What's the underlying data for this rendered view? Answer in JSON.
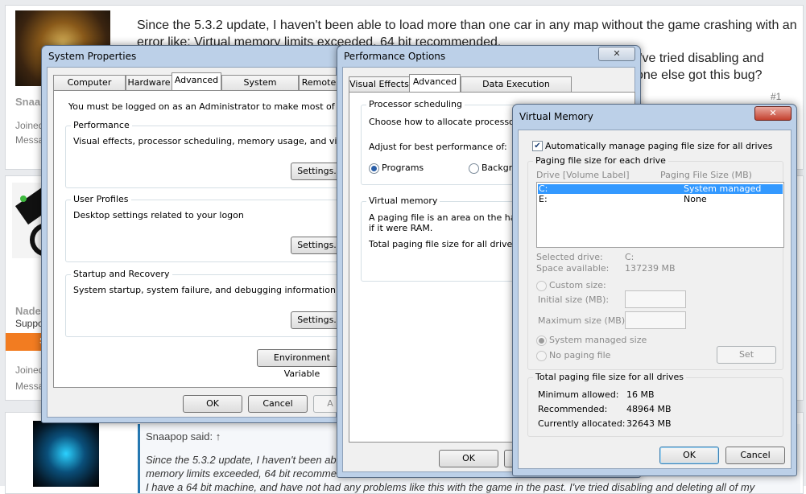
{
  "forum": {
    "post1": {
      "username": "Snaa",
      "joined_label": "Joined",
      "messages_label": "Messa",
      "line1": "Since the 5.3.2 update, I haven't been able to load more than one car in any map without the game crashing with an",
      "line2": "error like: Virtual memory limits exceeded, 64 bit recommended.",
      "line3_right": "I've tried disabling and",
      "line4_right": "one else got this bug?",
      "post_number": "#1"
    },
    "post2": {
      "username": "Nade",
      "role": "Suppo",
      "badge": "S",
      "joined_label": "Joined",
      "messages_label": "Messa"
    },
    "post3": {
      "quote_header": "Snaapop said: ↑",
      "quote_line1": "Since the 5.3.2 update, I haven't been able",
      "quote_line2": "memory limits exceeded, 64 bit recommen",
      "quote_line3": "I have a 64 bit machine, and have not had any problems like this with the game in the past. I've tried disabling and deleting all of my"
    }
  },
  "system_properties": {
    "title": "System Properties",
    "tabs": [
      "Computer Name",
      "Hardware",
      "Advanced",
      "System Protection",
      "Remote"
    ],
    "active_tab": "Advanced",
    "admin_note": "You must be logged on as an Administrator to make most of these chan",
    "performance": {
      "label": "Performance",
      "desc": "Visual effects, processor scheduling, memory usage, and virtual memo",
      "button": "Settings..."
    },
    "user_profiles": {
      "label": "User Profiles",
      "desc": "Desktop settings related to your logon",
      "button": "Settings..."
    },
    "startup": {
      "label": "Startup and Recovery",
      "desc": "System startup, system failure, and debugging information",
      "button": "Settings..."
    },
    "env_button": "Environment Variable",
    "ok": "OK",
    "cancel": "Cancel",
    "apply": "A"
  },
  "performance_options": {
    "title": "Performance Options",
    "close": "✕",
    "tabs": [
      "Visual Effects",
      "Advanced",
      "Data Execution Prevention"
    ],
    "active_tab": "Advanced",
    "processor": {
      "label": "Processor scheduling",
      "desc": "Choose how to allocate processor res",
      "adjust": "Adjust for best performance of:",
      "programs": "Programs",
      "background": "Backgrou"
    },
    "virtual": {
      "label": "Virtual memory",
      "desc1": "A paging file is an area on the hard di",
      "desc2": "if it were RAM.",
      "total": "Total paging file size for all drives:"
    },
    "ok": "OK"
  },
  "virtual_memory": {
    "title": "Virtual Memory",
    "close": "✕",
    "auto_manage": "Automatically manage paging file size for all drives",
    "each_drive_label": "Paging file size for each drive",
    "col_drive": "Drive  [Volume Label]",
    "col_size": "Paging File Size (MB)",
    "drives": [
      {
        "drive": "C:",
        "size": "System managed",
        "selected": true
      },
      {
        "drive": "E:",
        "size": "None",
        "selected": false
      }
    ],
    "selected_drive_label": "Selected drive:",
    "selected_drive_value": "C:",
    "space_label": "Space available:",
    "space_value": "137239 MB",
    "custom_size": "Custom size:",
    "initial_size": "Initial size (MB):",
    "maximum_size": "Maximum size (MB):",
    "system_managed": "System managed size",
    "no_paging": "No paging file",
    "set_button": "Set",
    "total_label": "Total paging file size for all drives",
    "min_label": "Minimum allowed:",
    "min_value": "16 MB",
    "rec_label": "Recommended:",
    "rec_value": "48964 MB",
    "cur_label": "Currently allocated:",
    "cur_value": "32643 MB",
    "ok": "OK",
    "cancel": "Cancel"
  },
  "colors": {
    "selection": "#3399ff",
    "orange_badge": "#f27c21",
    "forum_link": "#2577b1"
  }
}
